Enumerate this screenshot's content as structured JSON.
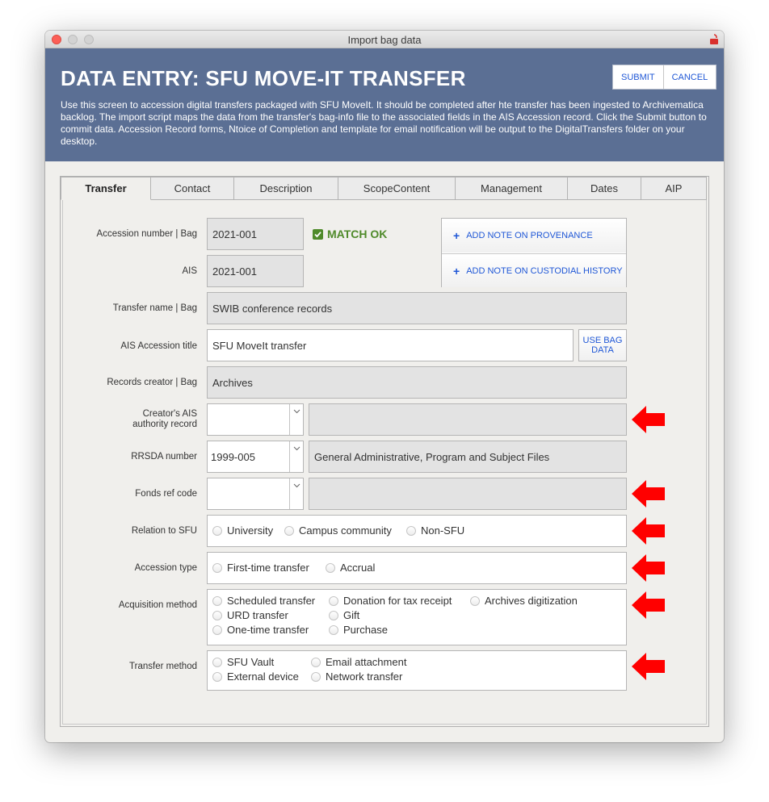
{
  "window": {
    "title": "Import bag data"
  },
  "header": {
    "title": "DATA ENTRY: SFU MOVE-IT TRANSFER",
    "intro": "Use this screen to accession digital transfers packaged with SFU MoveIt. It should be completed after hte transfer has been ingested to Archivematica backlog. The import script maps the data from the transfer's bag-info file to the associated fields in the AIS Accession record. Click the Submit button to commit data. Accession Record forms, Ntoice of Completion and template for email notification will be output to the DigitalTransfers folder on your desktop.",
    "submit_label": "SUBMIT",
    "cancel_label": "CANCEL"
  },
  "tabs": [
    "Transfer",
    "Contact",
    "Description",
    "ScopeContent",
    "Management",
    "Dates",
    "AIP"
  ],
  "active_tab": "Transfer",
  "form": {
    "accession_label": "Accession number | Bag",
    "accession_value": "2021-001",
    "match_text": "MATCH OK",
    "ais_label": "AIS",
    "ais_value": "2021-001",
    "note_provenance": "ADD NOTE ON PROVENANCE",
    "note_custodial": "ADD NOTE ON CUSTODIAL HISTORY",
    "transfer_name_label": "Transfer name | Bag",
    "transfer_name_value": "SWIB conference records",
    "ais_title_label": "AIS Accession title",
    "ais_title_value": "SFU MoveIt transfer",
    "use_bag_label_1": "USE BAG",
    "use_bag_label_2": "DATA",
    "creator_bag_label": "Records creator | Bag",
    "creator_bag_value": "Archives",
    "creator_ais_label_1": "Creator's AIS",
    "creator_ais_label_2": "authority record",
    "creator_ais_value": "",
    "creator_ais_name": "",
    "rrsda_label": "RRSDA number",
    "rrsda_value": "1999-005",
    "rrsda_desc": "General Administrative, Program and Subject Files",
    "fonds_label": "Fonds ref code",
    "fonds_value": "",
    "fonds_name": "",
    "relation_label": "Relation to SFU",
    "relation_options": [
      "University",
      "Campus community",
      "Non-SFU"
    ],
    "acc_type_label": "Accession type",
    "acc_type_options": [
      "First-time transfer",
      "Accrual"
    ],
    "acq_label": "Acquisition method",
    "acq_options": [
      "Scheduled transfer",
      "Donation for tax receipt",
      "Archives digitization",
      "URD transfer",
      "Gift",
      "One-time transfer",
      "Purchase"
    ],
    "transfer_method_label": "Transfer method",
    "transfer_method_options": [
      "SFU Vault",
      "Email attachment",
      "External device",
      "Network transfer"
    ]
  },
  "colors": {
    "header_bg": "#5b6f94",
    "link_blue": "#1f57d6",
    "match_green": "#4f8a2a",
    "arrow_red": "#ff0000"
  },
  "icons": [
    "lock-icon",
    "check-icon",
    "plus-icon",
    "chevron-down-icon",
    "red-arrow-icon"
  ]
}
